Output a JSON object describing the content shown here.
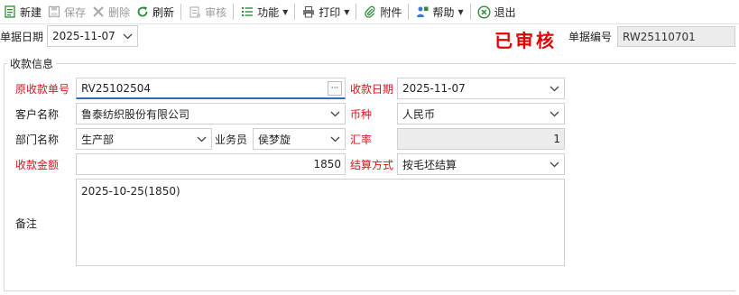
{
  "toolbar": {
    "new": "新建",
    "save": "保存",
    "delete": "删除",
    "refresh": "刷新",
    "audit": "审核",
    "functions": "功能",
    "print": "打印",
    "attachment": "附件",
    "help": "帮助",
    "exit": "退出"
  },
  "header": {
    "doc_date_label": "单据日期",
    "doc_date_value": "2025-11-07",
    "stamp": "已审核",
    "doc_no_label": "单据编号",
    "doc_no_value": "RW25110701"
  },
  "group": {
    "title": "收款信息"
  },
  "form": {
    "orig_no_label": "原收款单号",
    "orig_no_value": "RV25102504",
    "receipt_date_label": "收款日期",
    "receipt_date_value": "2025-11-07",
    "customer_label": "客户名称",
    "customer_value": "鲁泰纺织股份有限公司",
    "currency_label": "币种",
    "currency_value": "人民币",
    "dept_label": "部门名称",
    "dept_value": "生产部",
    "salesman_label": "业务员",
    "salesman_value": "侯梦旋",
    "rate_label": "汇率",
    "rate_value": "1",
    "amount_label": "收款金额",
    "amount_value": "1850",
    "settle_label": "结算方式",
    "settle_value": "按毛坯结算",
    "remark_label": "备注",
    "remark_value": "2025-10-25(1850)"
  },
  "colors": {
    "required_label": "#d4161b",
    "stamp": "#e00000",
    "focus_border": "#2b6cc4"
  }
}
